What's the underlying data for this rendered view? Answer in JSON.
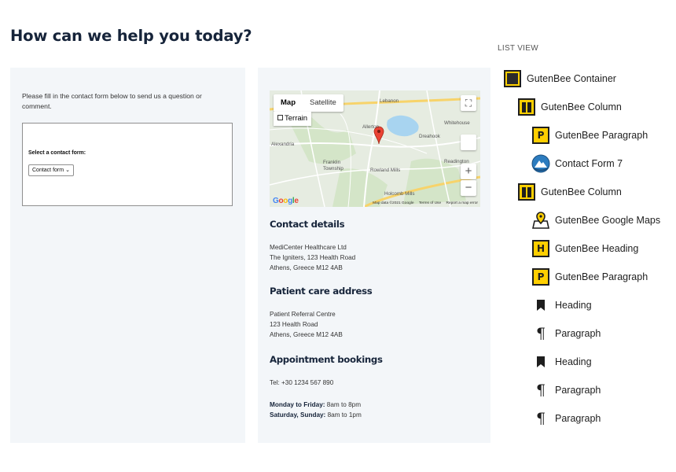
{
  "page": {
    "title": "How can we help you today?"
  },
  "contact_column": {
    "intro": "Please fill in the contact form below to send us a question or comment.",
    "form": {
      "label": "Select a contact form:",
      "select_value": "Contact form"
    }
  },
  "map": {
    "type_map": "Map",
    "type_satellite": "Satellite",
    "terrain_label": "Terrain",
    "google_logo": "Google",
    "attribution": {
      "data": "Map data ©2021 Google",
      "terms": "Terms of Use",
      "report": "Report a map error"
    },
    "places": [
      "Lebanon",
      "Whitehouse",
      "Allerton",
      "Dreahook",
      "Alexandria",
      "Readington",
      "Franklin Township",
      "Rowland Mills",
      "Holcomb Mills"
    ],
    "colors": {
      "land": "#e6ece1",
      "road_major": "#f7d36a",
      "water": "#a8d4f0",
      "marker": "#ea4335"
    }
  },
  "details_column": {
    "contact": {
      "heading": "Contact details",
      "line1": "MediCenter Healthcare Ltd",
      "line2": "The Igniters, 123 Health Road",
      "line3": "Athens, Greece M12 4AB"
    },
    "patient_care": {
      "heading": "Patient care address",
      "line1": "Patient Referral Centre",
      "line2": "123 Health Road",
      "line3": "Athens, Greece M12 4AB"
    },
    "appointments": {
      "heading": "Appointment bookings",
      "tel": "Tel: +30 1234 567 890",
      "weekday_label": "Monday to Friday:",
      "weekday_hours": "8am to 8pm",
      "weekend_label": "Saturday, Sunday:",
      "weekend_hours": "8am to 1pm"
    }
  },
  "list_view": {
    "title": "LIST VIEW",
    "items": [
      {
        "label": "GutenBee Container",
        "icon": "container-icon",
        "level": 0
      },
      {
        "label": "GutenBee Column",
        "icon": "column-icon",
        "level": 1
      },
      {
        "label": "GutenBee Paragraph",
        "icon": "gutenbee-paragraph-icon",
        "level": 2
      },
      {
        "label": "Contact Form 7",
        "icon": "contact-form-7-icon",
        "level": 2
      },
      {
        "label": "GutenBee Column",
        "icon": "column-icon",
        "level": 1
      },
      {
        "label": "GutenBee Google Maps",
        "icon": "map-pin-icon",
        "level": 2
      },
      {
        "label": "GutenBee Heading",
        "icon": "gutenbee-heading-icon",
        "level": 2
      },
      {
        "label": "GutenBee Paragraph",
        "icon": "gutenbee-paragraph-icon",
        "level": 2
      },
      {
        "label": "Heading",
        "icon": "bookmark-icon",
        "level": 2
      },
      {
        "label": "Paragraph",
        "icon": "pilcrow-icon",
        "level": 2
      },
      {
        "label": "Heading",
        "icon": "bookmark-icon",
        "level": 2
      },
      {
        "label": "Paragraph",
        "icon": "pilcrow-icon",
        "level": 2
      },
      {
        "label": "Paragraph",
        "icon": "pilcrow-icon",
        "level": 2
      }
    ],
    "colors": {
      "block_icon": "#ffcf00"
    }
  }
}
